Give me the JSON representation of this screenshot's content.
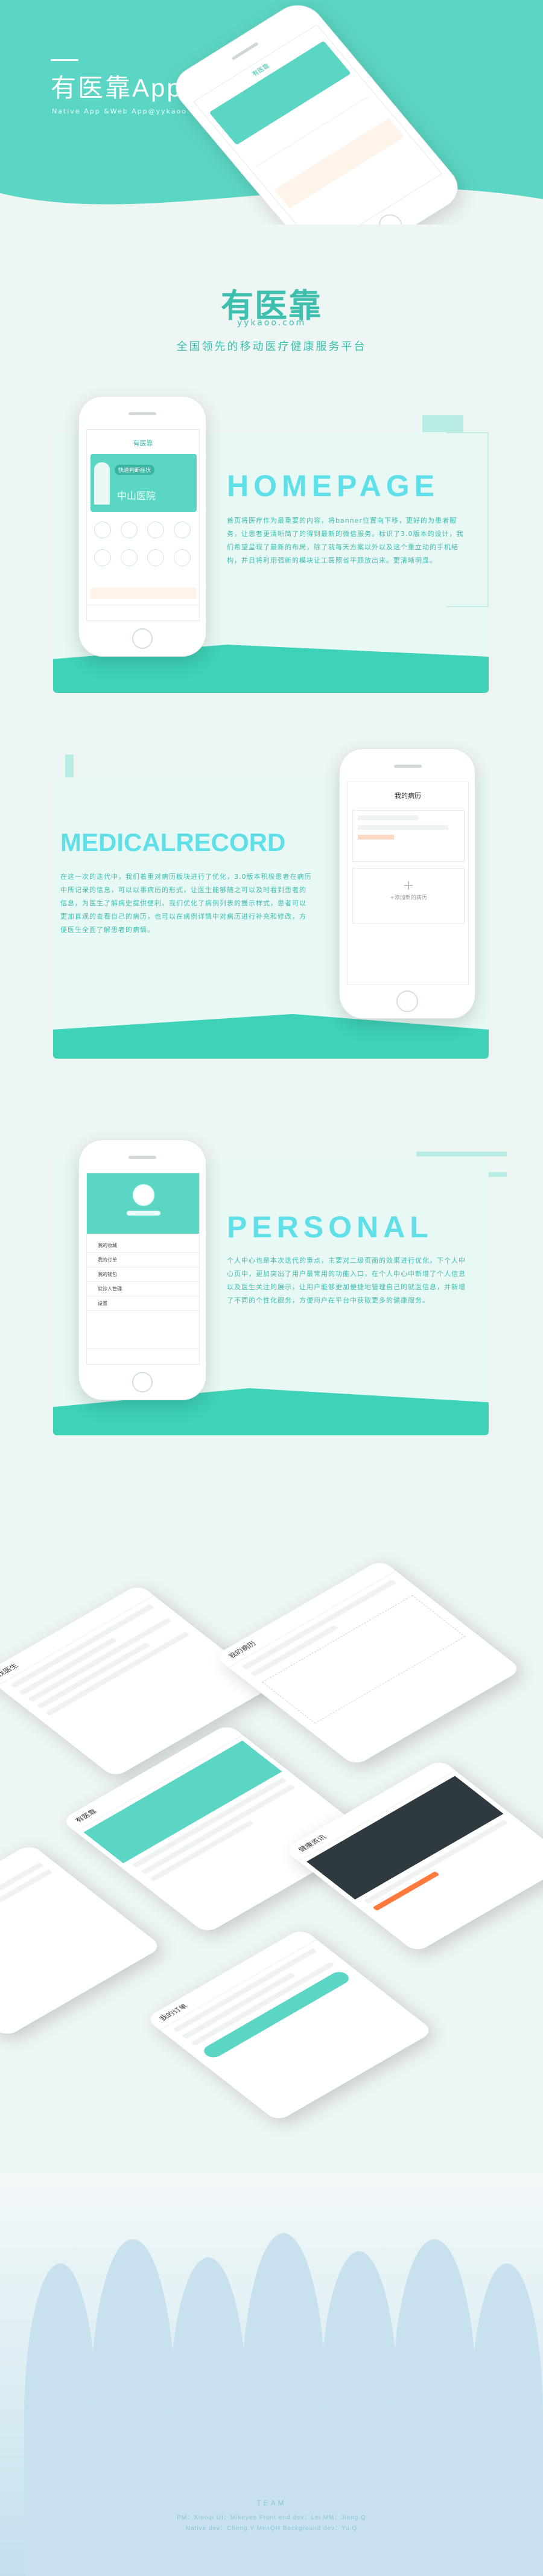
{
  "hero": {
    "title": "有医靠App",
    "subtitle": "Native App &Web App@yykaoo.com"
  },
  "brand": {
    "logo_text": "有医靠",
    "url": "yykaoo.com",
    "tagline": "全国领先的移动医疗健康服务平台"
  },
  "sections": {
    "homepage": {
      "heading": "HOMEPAGE",
      "body": "首页将医疗作为最重要的内容，将banner位置向下移，更好的为患者服务，让患者更清晰简了的得到最新的微信服务。标识了3.0版本的设计，我们希望呈现了最新的布局，除了就每天方案以外以及这个重立动的手机结构，并且将利用强新的模块让工医照省平顾放出来。更清晰明显。",
      "phone_header": "有医靠",
      "banner_title": "快速判断症状",
      "banner_sub": "中山医院"
    },
    "medical": {
      "heading": "MEDICALRECORD",
      "body": "在这一次的迭代中，我们着重对病历板块进行了优化，3.0版本积极患者在病历中所记录的信息，可以以事病历的形式，让医生能够随之可以及时看到患者的信息，为医生了解病史提供便利。我们优化了病例列表的展示样式，患者可以更加直观的查看自己的病历，也可以在病例详情中对病历进行补充和修改，方便医生全面了解患者的病情。",
      "phone_header": "我的病历",
      "add_label": "+添加新的病历"
    },
    "personal": {
      "heading": "PERSONAL",
      "body": "个人中心也是本次迭代的重点，主要对二级页面的效果进行优化，下个人中心页中，更加突出了用户最常用的功能入口，在个人中心中新增了个人信息以及医生关注的展示，让用户能够更加便捷地管理自己的就医信息，并新增了不同的个性化服务，方便用户在平台中获取更多的健康服务。",
      "phone_items": [
        "我的收藏",
        "我的订单",
        "我的钱包",
        "就诊人管理",
        "设置"
      ]
    }
  },
  "collage": {
    "screens": [
      "找医生",
      "我的病历",
      "有医靠",
      "健康资讯",
      "我的订单"
    ]
  },
  "footer": {
    "label": "TEAM",
    "credits": "PM：Xiaoqi  UI：Mikeyee  Front end dev：Lei  MM：Jiang.Q",
    "credits2": "Native dev：Cheng.Y MenQH  Background dev：Yu.Q"
  },
  "colors": {
    "accent": "#5cd6c4",
    "accent_dark": "#3ed2b8",
    "heading": "#5fdfe8",
    "bg": "#eef6f4"
  }
}
